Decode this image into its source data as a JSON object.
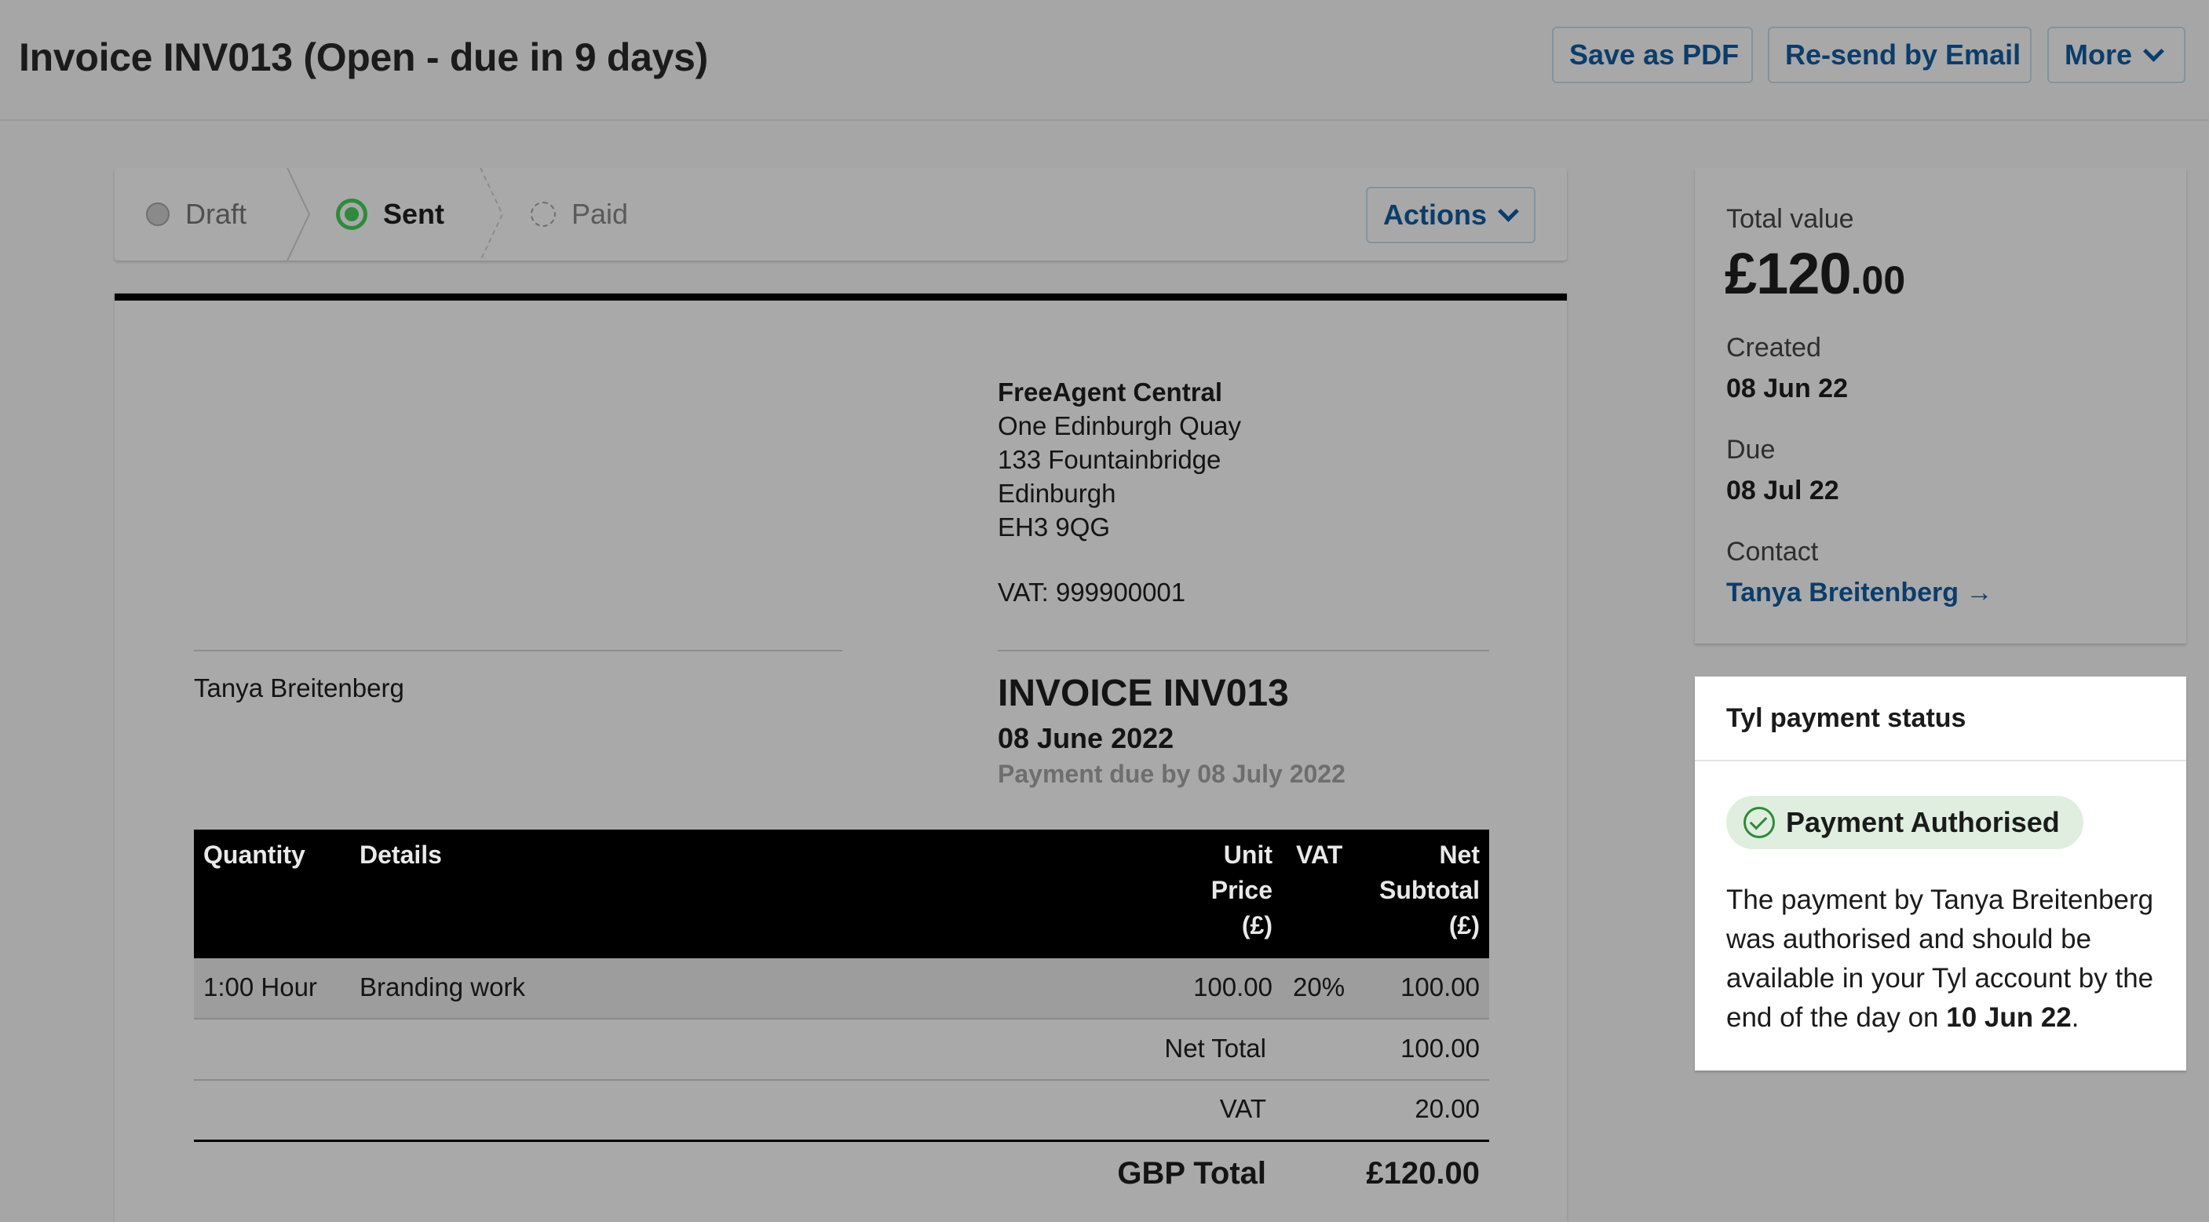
{
  "header": {
    "title": "Invoice INV013 (Open - due in 9 days)",
    "buttons": {
      "save_pdf": "Save as PDF",
      "resend": "Re-send by Email",
      "more": "More"
    }
  },
  "status": {
    "steps": [
      {
        "label": "Draft",
        "state": "done"
      },
      {
        "label": "Sent",
        "state": "current"
      },
      {
        "label": "Paid",
        "state": "pending"
      }
    ],
    "actions_label": "Actions"
  },
  "invoice": {
    "from": {
      "company": "FreeAgent Central",
      "address": [
        "One Edinburgh Quay",
        "133 Fountainbridge",
        "Edinburgh",
        "EH3 9QG"
      ],
      "vat": "VAT: 999900001"
    },
    "client": "Tanya Breitenberg",
    "title": "INVOICE INV013",
    "date": "08 June 2022",
    "payment_due": "Payment due by 08 July 2022",
    "table": {
      "headers": {
        "quantity": "Quantity",
        "details": "Details",
        "unit_price": [
          "Unit",
          "Price",
          "(£)"
        ],
        "vat": "VAT",
        "net_subtotal": [
          "Net",
          "Subtotal",
          "(£)"
        ]
      },
      "rows": [
        {
          "quantity": "1:00 Hour",
          "details": "Branding work",
          "unit_price": "100.00",
          "vat": "20%",
          "net_subtotal": "100.00"
        }
      ]
    },
    "totals": {
      "net_total_label": "Net Total",
      "net_total": "100.00",
      "vat_label": "VAT",
      "vat": "20.00",
      "grand_label": "GBP Total",
      "grand": "£120.00"
    }
  },
  "summary": {
    "total_label": "Total value",
    "total_main": "£120",
    "total_decimal": ".00",
    "created_label": "Created",
    "created": "08 Jun 22",
    "due_label": "Due",
    "due": "08 Jul 22",
    "contact_label": "Contact",
    "contact": "Tanya Breitenberg →"
  },
  "tyl": {
    "title": "Tyl payment status",
    "badge": "Payment Authorised",
    "message_prefix": "The payment by Tanya Breitenberg was authorised and should be available in your Tyl account by the end of the day on ",
    "message_date": "10 Jun 22",
    "message_suffix": "."
  },
  "colors": {
    "link": "#0b3d6b",
    "success": "#2e8a3c",
    "badge_bg": "#dfeede"
  }
}
